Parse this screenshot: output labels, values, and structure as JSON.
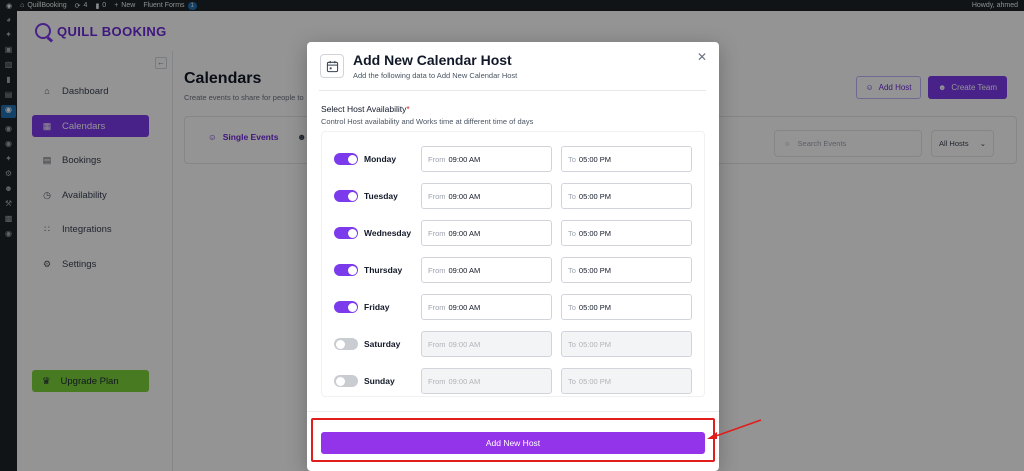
{
  "admin_bar": {
    "site_name": "QuillBooking",
    "updates_count": "4",
    "comments_count": "0",
    "new_label": "New",
    "fluent_forms_label": "Fluent Forms",
    "fluent_forms_badge": "1",
    "howdy": "Howdy, ahmed"
  },
  "wp_sidebar": {
    "icons": [
      "dashboard-icon",
      "pin-icon",
      "media-icon",
      "pages-icon",
      "comments-icon",
      "form-icon",
      "quillbooking-icon",
      "quill-icon",
      "quill-icon-2",
      "appearance-icon",
      "plugins-icon",
      "users-icon",
      "tools-icon",
      "settings-icon",
      "collapse-icon"
    ]
  },
  "brand": {
    "name": "QUILL BOOKING"
  },
  "nav": {
    "items": [
      {
        "label": "Dashboard",
        "icon": "home-icon",
        "active": false
      },
      {
        "label": "Calendars",
        "icon": "calendar-icon",
        "active": true
      },
      {
        "label": "Bookings",
        "icon": "bookings-icon",
        "active": false
      },
      {
        "label": "Availability",
        "icon": "clock-icon",
        "active": false
      },
      {
        "label": "Integrations",
        "icon": "integrations-icon",
        "active": false
      },
      {
        "label": "Settings",
        "icon": "gear-icon",
        "active": false
      }
    ],
    "upgrade_label": "Upgrade Plan"
  },
  "main": {
    "title": "Calendars",
    "subtitle": "Create events to share for people to",
    "add_host_label": "Add Host",
    "create_team_label": "Create Team",
    "tab_single_events": "Single Events",
    "search_placeholder": "Search Events",
    "filter_selected": "All Hosts"
  },
  "modal": {
    "title": "Add New Calendar Host",
    "subtitle": "Add the following data to Add New Calendar Host",
    "availability_label": "Select Host Availability",
    "availability_required": "*",
    "availability_desc": "Control Host availability and Works time at different time of days",
    "from_prefix": "From",
    "to_prefix": "To",
    "days": [
      {
        "name": "Monday",
        "enabled": true,
        "from": "09:00 AM",
        "to": "05:00 PM"
      },
      {
        "name": "Tuesday",
        "enabled": true,
        "from": "09:00 AM",
        "to": "05:00 PM"
      },
      {
        "name": "Wednesday",
        "enabled": true,
        "from": "09:00 AM",
        "to": "05:00 PM"
      },
      {
        "name": "Thursday",
        "enabled": true,
        "from": "09:00 AM",
        "to": "05:00 PM"
      },
      {
        "name": "Friday",
        "enabled": true,
        "from": "09:00 AM",
        "to": "05:00 PM"
      },
      {
        "name": "Saturday",
        "enabled": false,
        "from": "09:00 AM",
        "to": "05:00 PM"
      },
      {
        "name": "Sunday",
        "enabled": false,
        "from": "09:00 AM",
        "to": "05:00 PM"
      }
    ],
    "submit_label": "Add New Host"
  },
  "colors": {
    "accent": "#7c3aed",
    "submit": "#9333ea",
    "upgrade": "#7bd33a",
    "highlight": "#e11d1d"
  }
}
